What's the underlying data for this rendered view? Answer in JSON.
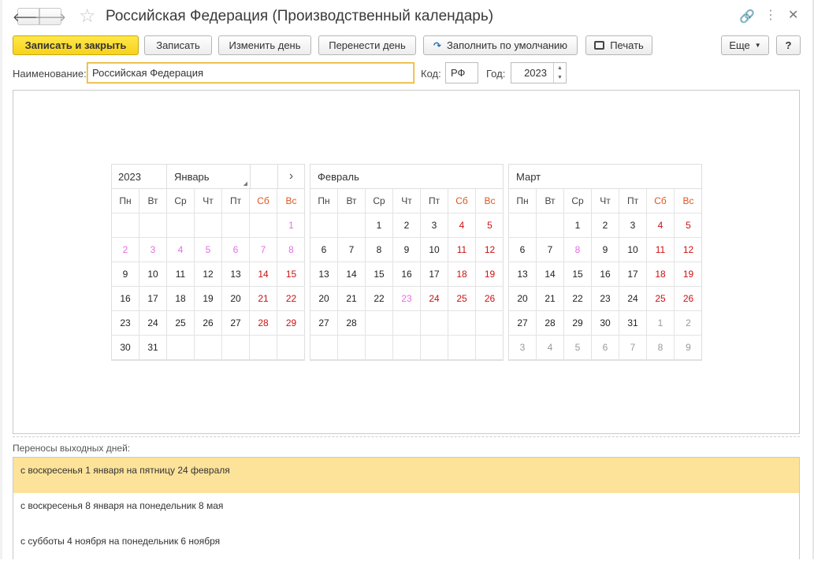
{
  "window": {
    "title": "Российская Федерация (Производственный календарь)",
    "icons": [
      "back-arrow-icon",
      "forward-arrow-icon",
      "star-icon",
      "link-icon",
      "more-icon",
      "close-icon"
    ]
  },
  "toolbar": {
    "save_close": "Записать и закрыть",
    "save": "Записать",
    "change_day": "Изменить день",
    "move_day": "Перенести день",
    "fill_default": "Заполнить по умолчанию",
    "print": "Печать",
    "more": "Еще",
    "help": "?"
  },
  "form": {
    "name_label": "Наименование:",
    "name_value": "Российская Федерация",
    "code_label": "Код:",
    "code_value": "РФ",
    "year_label": "Год:",
    "year_value": "2023"
  },
  "colors": {
    "accent_yellow": "#f8d21b",
    "holiday_red": "#cc1111",
    "weekend_header": "#e0561f",
    "pre_holiday_pink": "#e56de5",
    "other_month_gray": "#999999",
    "selected_row": "#fde39a"
  },
  "calendar": {
    "year": "2023",
    "nav_next": "›",
    "weekdays": [
      "Пн",
      "Вт",
      "Ср",
      "Чт",
      "Пт",
      "Сб",
      "Вс"
    ],
    "weekend_flags": [
      false,
      false,
      false,
      false,
      false,
      true,
      true
    ],
    "months": [
      {
        "name": "Январь",
        "days": [
          [
            "",
            "",
            "",
            "",
            "",
            "",
            "1"
          ],
          [
            "2",
            "3",
            "4",
            "5",
            "6",
            "7",
            "8"
          ],
          [
            "9",
            "10",
            "11",
            "12",
            "13",
            "14",
            "15"
          ],
          [
            "16",
            "17",
            "18",
            "19",
            "20",
            "21",
            "22"
          ],
          [
            "23",
            "24",
            "25",
            "26",
            "27",
            "28",
            "29"
          ],
          [
            "30",
            "31",
            "",
            "",
            "",
            "",
            ""
          ]
        ],
        "types": [
          [
            "",
            "",
            "",
            "",
            "",
            "",
            "p"
          ],
          [
            "p",
            "p",
            "p",
            "p",
            "p",
            "p",
            "p"
          ],
          [
            "n",
            "n",
            "n",
            "n",
            "n",
            "h",
            "h"
          ],
          [
            "n",
            "n",
            "n",
            "n",
            "n",
            "h",
            "h"
          ],
          [
            "n",
            "n",
            "n",
            "n",
            "n",
            "h",
            "h"
          ],
          [
            "n",
            "n",
            "",
            "",
            "",
            "",
            ""
          ]
        ]
      },
      {
        "name": "Февраль",
        "days": [
          [
            "",
            "",
            "1",
            "2",
            "3",
            "4",
            "5"
          ],
          [
            "6",
            "7",
            "8",
            "9",
            "10",
            "11",
            "12"
          ],
          [
            "13",
            "14",
            "15",
            "16",
            "17",
            "18",
            "19"
          ],
          [
            "20",
            "21",
            "22",
            "23",
            "24",
            "25",
            "26"
          ],
          [
            "27",
            "28",
            "",
            "",
            "",
            "",
            ""
          ],
          [
            "",
            "",
            "",
            "",
            "",
            "",
            ""
          ]
        ],
        "types": [
          [
            "",
            "",
            "n",
            "n",
            "n",
            "h",
            "h"
          ],
          [
            "n",
            "n",
            "n",
            "n",
            "n",
            "h",
            "h"
          ],
          [
            "n",
            "n",
            "n",
            "n",
            "n",
            "h",
            "h"
          ],
          [
            "n",
            "n",
            "n",
            "p",
            "h",
            "h",
            "h"
          ],
          [
            "n",
            "n",
            "",
            "",
            "",
            "",
            ""
          ],
          [
            "",
            "",
            "",
            "",
            "",
            "",
            ""
          ]
        ]
      },
      {
        "name": "Март",
        "days": [
          [
            "",
            "",
            "1",
            "2",
            "3",
            "4",
            "5"
          ],
          [
            "6",
            "7",
            "8",
            "9",
            "10",
            "11",
            "12"
          ],
          [
            "13",
            "14",
            "15",
            "16",
            "17",
            "18",
            "19"
          ],
          [
            "20",
            "21",
            "22",
            "23",
            "24",
            "25",
            "26"
          ],
          [
            "27",
            "28",
            "29",
            "30",
            "31",
            "1",
            "2"
          ],
          [
            "3",
            "4",
            "5",
            "6",
            "7",
            "8",
            "9"
          ]
        ],
        "types": [
          [
            "",
            "",
            "n",
            "n",
            "n",
            "h",
            "h"
          ],
          [
            "n",
            "n",
            "p",
            "n",
            "n",
            "h",
            "h"
          ],
          [
            "n",
            "n",
            "n",
            "n",
            "n",
            "h",
            "h"
          ],
          [
            "n",
            "n",
            "n",
            "n",
            "n",
            "h",
            "h"
          ],
          [
            "n",
            "n",
            "n",
            "n",
            "n",
            "g",
            "g"
          ],
          [
            "g",
            "g",
            "g",
            "g",
            "g",
            "g",
            "g"
          ]
        ]
      }
    ]
  },
  "transfers": {
    "label": "Переносы выходных дней:",
    "items": [
      {
        "text": "с воскресенья 1 января на пятницу 24 февраля",
        "selected": true
      },
      {
        "text": "с воскресенья 8 января на понедельник 8 мая",
        "selected": false
      },
      {
        "text": "с субботы 4 ноября на понедельник 6 ноября",
        "selected": false
      }
    ]
  }
}
